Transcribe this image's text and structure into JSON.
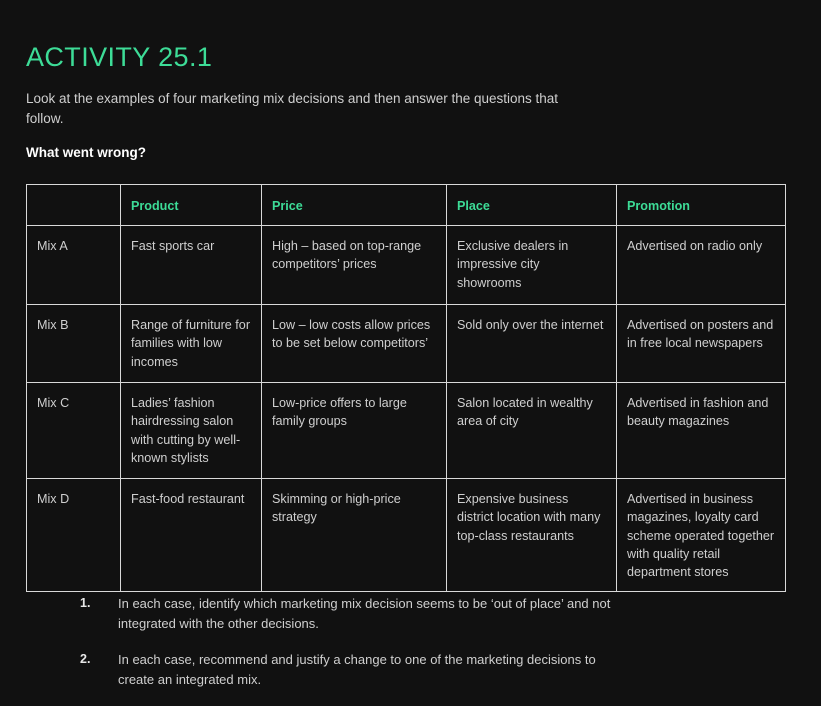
{
  "activity": {
    "title": "ACTIVITY 25.1",
    "intro": "Look at the examples of four marketing mix decisions and then answer the questions that follow.",
    "subheading": "What went wrong?"
  },
  "table": {
    "headers": [
      "",
      "Product",
      "Price",
      "Place",
      "Promotion"
    ],
    "rows": [
      {
        "mix": "Mix A",
        "product": "Fast sports car",
        "price": "High – based on top-range competitors’ prices",
        "place": "Exclusive dealers in impressive city showrooms",
        "promotion": "Advertised on radio only"
      },
      {
        "mix": "Mix B",
        "product": "Range of furniture for families with low incomes",
        "price": "Low – low costs allow prices to be set below competitors’",
        "place": "Sold only over the internet",
        "promotion": "Advertised on posters and in free local newspapers"
      },
      {
        "mix": "Mix C",
        "product": "Ladies’ fashion hairdressing salon with cutting by well-known stylists",
        "price": "Low-price offers to large family groups",
        "place": "Salon located in wealthy area of city",
        "promotion": "Advertised in fashion and beauty magazines"
      },
      {
        "mix": "Mix D",
        "product": "Fast-food restaurant",
        "price": "Skimming or high-price strategy",
        "place": "Expensive business district location with many top-class restaurants",
        "promotion": "Advertised in business magazines, loyalty card scheme operated together with quality retail department stores"
      }
    ]
  },
  "questions": [
    {
      "number": "1.",
      "text": "In each case, identify which marketing mix decision seems to be ‘out of place’ and not integrated with the other decisions."
    },
    {
      "number": "2.",
      "text": "In each case, recommend and justify a change to one of the marketing decisions to create an integrated mix."
    }
  ],
  "colors": {
    "background": "#111111",
    "accent_green": "#3ddc97",
    "body_text": "#cfcfcf",
    "heading_text": "#ffffff",
    "table_border": "#d9d9d9"
  }
}
